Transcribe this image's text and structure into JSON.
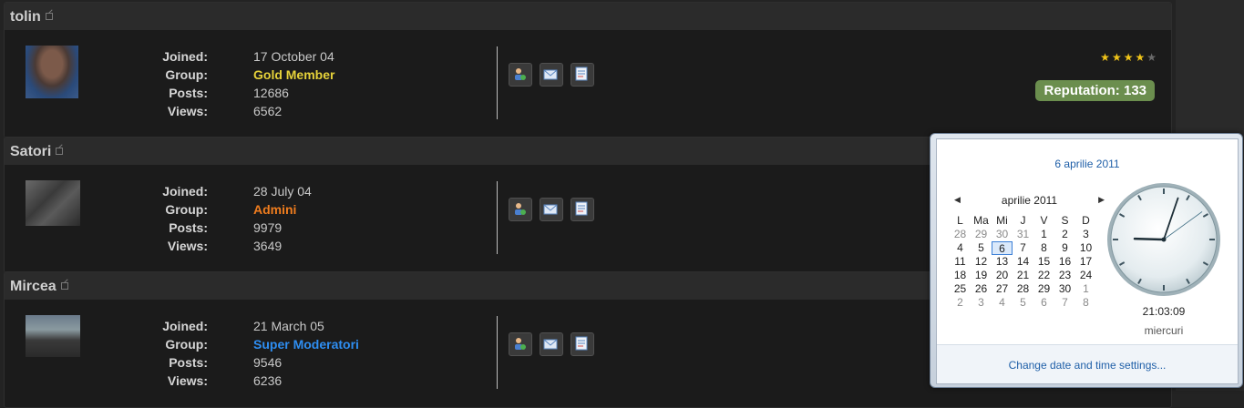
{
  "labels": {
    "joined": "Joined:",
    "group": "Group:",
    "posts": "Posts:",
    "views": "Views:"
  },
  "members": [
    {
      "name": "tolin",
      "joined": "17 October 04",
      "group": "Gold Member",
      "posts": "12686",
      "views": "6562",
      "rating": 4,
      "rating_max": 5,
      "reputation": "Reputation: 133"
    },
    {
      "name": "Satori",
      "joined": "28 July 04",
      "group": "Admini",
      "posts": "9979",
      "views": "3649"
    },
    {
      "name": "Mircea",
      "joined": "21 March 05",
      "group": "Super Moderatori",
      "posts": "9546",
      "views": "6236"
    }
  ],
  "action_icons": [
    "add-friend-icon",
    "send-message-icon",
    "view-posts-icon"
  ],
  "calendar": {
    "date_header": "6 aprilie 2011",
    "month_label": "aprilie 2011",
    "weekdays": [
      "L",
      "Ma",
      "Mi",
      "J",
      "V",
      "S",
      "D"
    ],
    "weeks": [
      [
        "28",
        "29",
        "30",
        "31",
        "1",
        "2",
        "3"
      ],
      [
        "4",
        "5",
        "6",
        "7",
        "8",
        "9",
        "10"
      ],
      [
        "11",
        "12",
        "13",
        "14",
        "15",
        "16",
        "17"
      ],
      [
        "18",
        "19",
        "20",
        "21",
        "22",
        "23",
        "24"
      ],
      [
        "25",
        "26",
        "27",
        "28",
        "29",
        "30",
        "1"
      ],
      [
        "2",
        "3",
        "4",
        "5",
        "6",
        "7",
        "8"
      ]
    ],
    "today": "6",
    "time": "21:03:09",
    "weekday_name": "miercuri",
    "settings_link": "Change date and time settings..."
  },
  "colors": {
    "gold_member": "#e6d23a",
    "admini": "#f07d1e",
    "super_moderatori": "#2e8ef2",
    "reputation_bg": "#6b8e4e"
  }
}
